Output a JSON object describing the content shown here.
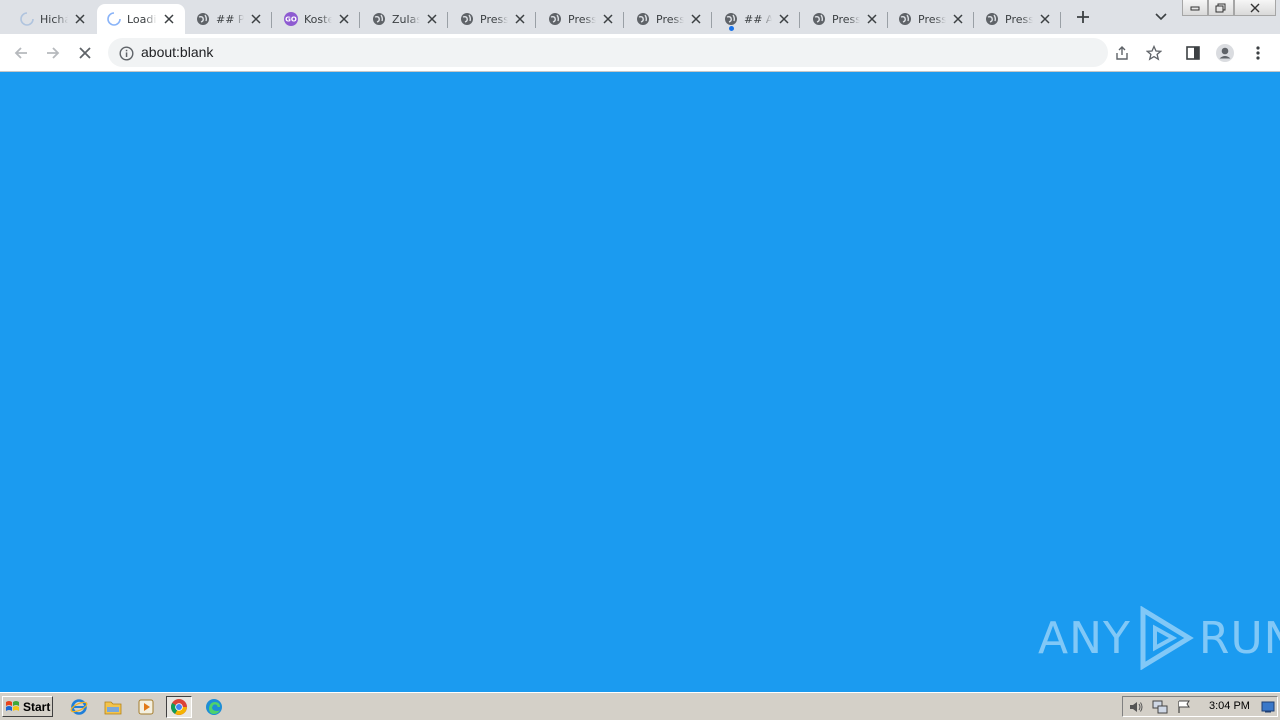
{
  "browser": {
    "tabs": [
      {
        "title": "Hichá",
        "favicon": "loading-spinner-icon",
        "active": false
      },
      {
        "title": "Loadi",
        "favicon": "loading-spinner-icon",
        "active": true
      },
      {
        "title": "## P",
        "favicon": "globe-icon",
        "active": false
      },
      {
        "title": "Koste",
        "favicon": "go-badge-icon",
        "active": false
      },
      {
        "title": "Zulas",
        "favicon": "globe-icon",
        "active": false
      },
      {
        "title": "Press",
        "favicon": "globe-icon",
        "active": false
      },
      {
        "title": "Press",
        "favicon": "globe-icon",
        "active": false
      },
      {
        "title": "Press",
        "favicon": "globe-icon",
        "active": false
      },
      {
        "title": "## A",
        "favicon": "globe-icon",
        "active": false
      },
      {
        "title": "Press",
        "favicon": "globe-icon",
        "active": false
      },
      {
        "title": "Press",
        "favicon": "globe-icon",
        "active": false
      },
      {
        "title": "Press",
        "favicon": "globe-icon",
        "active": false
      }
    ],
    "address": {
      "url": "about:blank"
    }
  },
  "watermark": {
    "left": "ANY",
    "right": "RUN"
  },
  "taskbar": {
    "start_label": "Start",
    "clock": "3:04 PM"
  },
  "colors": {
    "page_background": "#1b9bf0",
    "tabstrip": "#dee1e6",
    "taskbar": "#d4d0c8"
  }
}
